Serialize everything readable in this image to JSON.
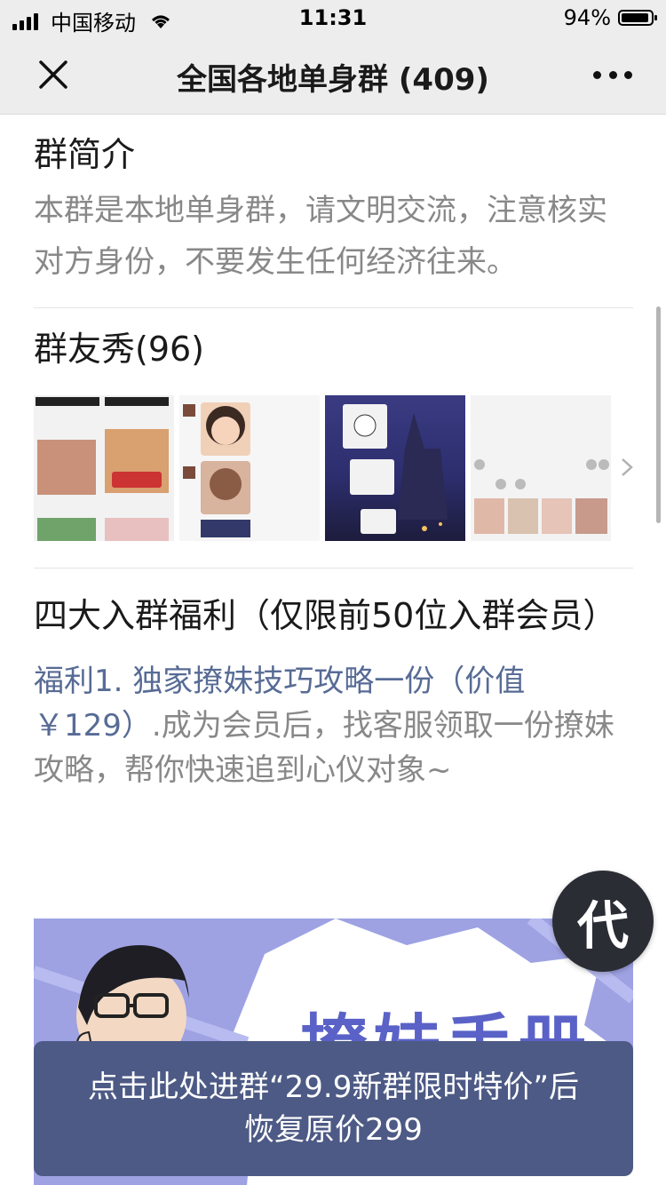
{
  "status_bar": {
    "carrier": "中国移动",
    "time": "11:31",
    "battery_percent_label": "94%",
    "battery_level": 0.94,
    "icons": [
      "signal-icon",
      "wifi-icon",
      "battery-icon"
    ]
  },
  "nav": {
    "title": "全国各地单身群 (409)",
    "icons": [
      "close-icon",
      "more-icon"
    ]
  },
  "intro": {
    "title": "群简介",
    "text": "本群是本地单身群，请文明交流，注意核实对方身份，不要发生任何经济往来。"
  },
  "group_show": {
    "title": "群友秀(96)",
    "thumb_count": 4
  },
  "benefits": {
    "title": "四大入群福利（仅限前50位入群会员）",
    "item1_highlight": "福利1. 独家撩妹技巧攻略一份（价值￥129）",
    "item1_rest": ".成为会员后，找客服领取一份撩妹攻略，帮你快速追到心仪对象~"
  },
  "banner": {
    "title": "撩妹手册"
  },
  "fab": {
    "label": "代"
  },
  "cta": {
    "line1": "点击此处进群“29.9新群限时特价”后",
    "line2": "恢复原价299"
  },
  "colors": {
    "nav_bg": "#ededed",
    "link": "#576b95",
    "cta_bg": "#4d5a85",
    "muted_text": "#888888",
    "banner_bg": "#9ea2e3"
  }
}
